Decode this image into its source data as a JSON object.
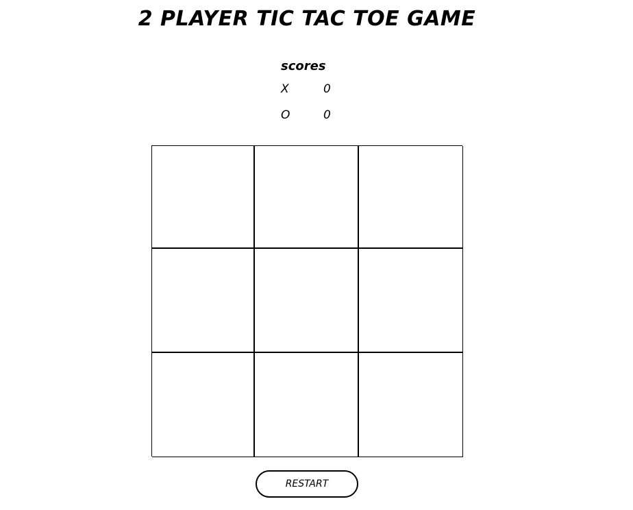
{
  "header": {
    "title": "2 PLAYER TIC TAC TOE GAME"
  },
  "scores": {
    "heading": "scores",
    "rows": [
      {
        "player": "X",
        "score": "0"
      },
      {
        "player": "O",
        "score": "0"
      }
    ]
  },
  "board": {
    "cells": [
      "",
      "",
      "",
      "",
      "",
      "",
      "",
      "",
      ""
    ]
  },
  "controls": {
    "restart_label": "RESTART"
  }
}
